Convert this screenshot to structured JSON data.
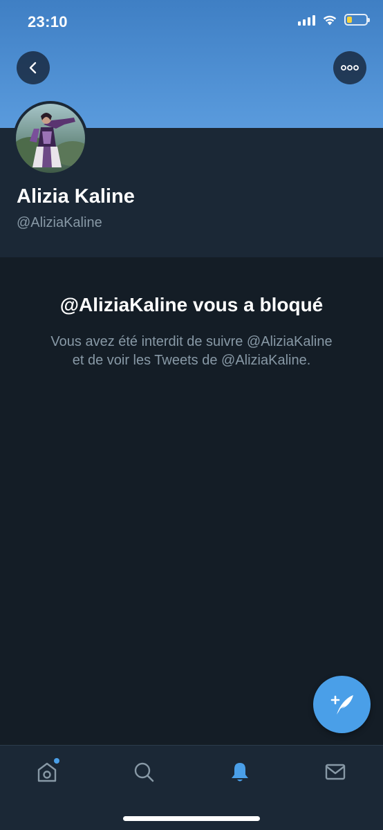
{
  "status_bar": {
    "time": "23:10",
    "battery_level": 0.25,
    "battery_color": "#f6d23c"
  },
  "header": {
    "back_icon": "chevron-left-icon",
    "more_icon": "ellipsis-icon",
    "banner_color": "#4a8bd1"
  },
  "profile": {
    "display_name": "Alizia Kaline",
    "handle": "@AliziaKaline"
  },
  "blocked": {
    "title": "@AliziaKaline vous a bloqué",
    "message": "Vous avez été interdit de suivre @AliziaKaline et de voir les Tweets de @AliziaKaline."
  },
  "fab": {
    "icon": "compose-tweet-icon",
    "color": "#4a9fe8"
  },
  "tab_bar": {
    "tabs": [
      {
        "icon": "home-icon",
        "active": false,
        "has_dot": true
      },
      {
        "icon": "search-icon",
        "active": false
      },
      {
        "icon": "bell-icon",
        "active": true
      },
      {
        "icon": "mail-icon",
        "active": false
      }
    ],
    "active_color": "#4a9fe8",
    "inactive_color": "#8899a6"
  }
}
